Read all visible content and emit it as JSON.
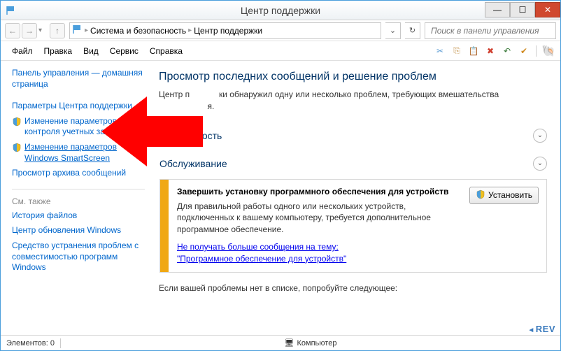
{
  "window": {
    "title": "Центр поддержки"
  },
  "breadcrumb": {
    "item1": "Система и безопасность",
    "item2": "Центр поддержки"
  },
  "search": {
    "placeholder": "Поиск в панели управления"
  },
  "menu": {
    "file": "Файл",
    "edit": "Правка",
    "view": "Вид",
    "service": "Сервис",
    "help": "Справка"
  },
  "sidebar": {
    "home": "Панель управления — домашняя страница",
    "params": "Параметры Центра поддержки",
    "uac": "Изменение параметров контроля учетных записей",
    "smartscreen": "Изменение параметров Windows SmartScreen",
    "archive": "Просмотр архива сообщений",
    "seealso_label": "См. также",
    "filehistory": "История файлов",
    "winupdate": "Центр обновления Windows",
    "compat": "Средство устранения проблем с совместимостью программ Windows"
  },
  "main": {
    "heading": "Просмотр последних сообщений и решение проблем",
    "intro_partial1": "Центр п",
    "intro_partial2": "ки обнаружил одну или несколько проблем, требующих вмешательства",
    "intro_partial3": "я.",
    "sec_security": "пасность",
    "sec_maintenance": "Обслуживание",
    "notice": {
      "title": "Завершить установку программного обеспечения для устройств",
      "desc": "Для правильной работы одного или нескольких устройств, подключенных к вашему компьютеру, требуется дополнительное программное обеспечение.",
      "link1": "Не получать больше сообщения на тему:",
      "link2": "\"Программное обеспечение для устройств\"",
      "install": "Установить"
    },
    "footer": "Если вашей проблемы нет в списке, попробуйте следующее:"
  },
  "status": {
    "elements": "Элементов: 0",
    "computer": "Компьютер"
  },
  "watermark": "REV"
}
